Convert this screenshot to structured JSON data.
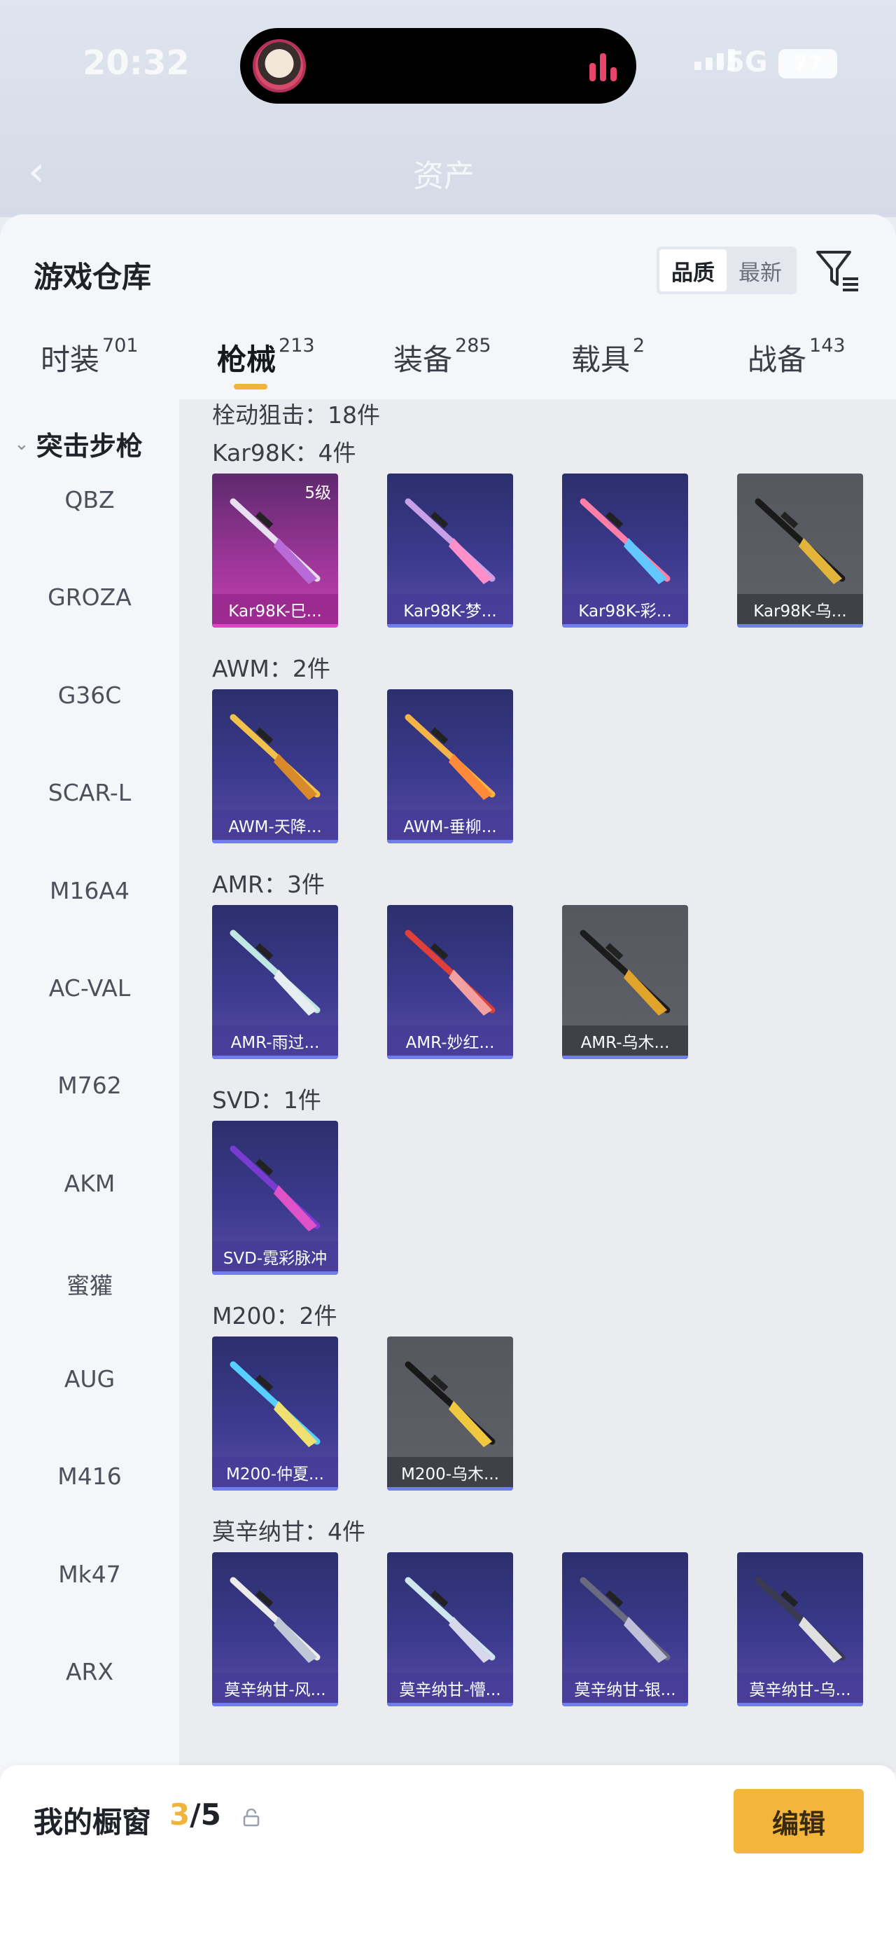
{
  "status_bar": {
    "time": "20:32",
    "network": "5G",
    "battery": "77"
  },
  "background_page": {
    "title": "资产"
  },
  "header": {
    "title": "游戏仓库",
    "sort_options": [
      "品质",
      "最新"
    ],
    "active_sort": "品质"
  },
  "tabs": [
    {
      "label": "时装",
      "count": "701"
    },
    {
      "label": "枪械",
      "count": "213",
      "active": true
    },
    {
      "label": "装备",
      "count": "285"
    },
    {
      "label": "载具",
      "count": "2"
    },
    {
      "label": "战备",
      "count": "143"
    }
  ],
  "categories": {
    "heading": "突击步枪",
    "items": [
      "QBZ",
      "GROZA",
      "G36C",
      "SCAR-L",
      "M16A4",
      "AC-VAL",
      "M762",
      "AKM",
      "蜜獾",
      "AUG",
      "M416",
      "Mk47",
      "ARX"
    ]
  },
  "sections": {
    "partial_header": "栓动狙击：18件",
    "groups": [
      {
        "label": "Kar98K：4件",
        "items": [
          {
            "name": "Kar98K-巳...",
            "rarity": "pink",
            "level": "5级"
          },
          {
            "name": "Kar98K-梦...",
            "rarity": "purple"
          },
          {
            "name": "Kar98K-彩...",
            "rarity": "purple"
          },
          {
            "name": "Kar98K-乌...",
            "rarity": "gray"
          }
        ]
      },
      {
        "label": "AWM：2件",
        "items": [
          {
            "name": "AWM-天降...",
            "rarity": "purple"
          },
          {
            "name": "AWM-垂柳...",
            "rarity": "purple"
          }
        ]
      },
      {
        "label": "AMR：3件",
        "items": [
          {
            "name": "AMR-雨过...",
            "rarity": "purple"
          },
          {
            "name": "AMR-妙红...",
            "rarity": "purple"
          },
          {
            "name": "AMR-乌木...",
            "rarity": "gray"
          }
        ]
      },
      {
        "label": "SVD：1件",
        "items": [
          {
            "name": "SVD-霓彩脉冲",
            "rarity": "purple"
          }
        ]
      },
      {
        "label": "M200：2件",
        "items": [
          {
            "name": "M200-仲夏...",
            "rarity": "purple"
          },
          {
            "name": "M200-乌木...",
            "rarity": "gray"
          }
        ]
      },
      {
        "label": "莫辛纳甘：4件",
        "items": [
          {
            "name": "莫辛纳甘-风...",
            "rarity": "purple"
          },
          {
            "name": "莫辛纳甘-懵...",
            "rarity": "purple"
          },
          {
            "name": "莫辛纳甘-银...",
            "rarity": "purple"
          },
          {
            "name": "莫辛纳甘-乌...",
            "rarity": "purple"
          }
        ]
      }
    ]
  },
  "showcase": {
    "label": "我的橱窗",
    "current": "3",
    "total": "/5"
  },
  "edit_button": "编辑",
  "colors": {
    "accent": "#f3b63b",
    "purple_card": "#3b3a8e",
    "pink_card": "#9a3597",
    "gray_card": "#5e6168"
  },
  "icons": {
    "filter": "filter-icon",
    "share": "share-external-icon",
    "lock": "lock-icon",
    "back": "chevron-left-icon"
  }
}
